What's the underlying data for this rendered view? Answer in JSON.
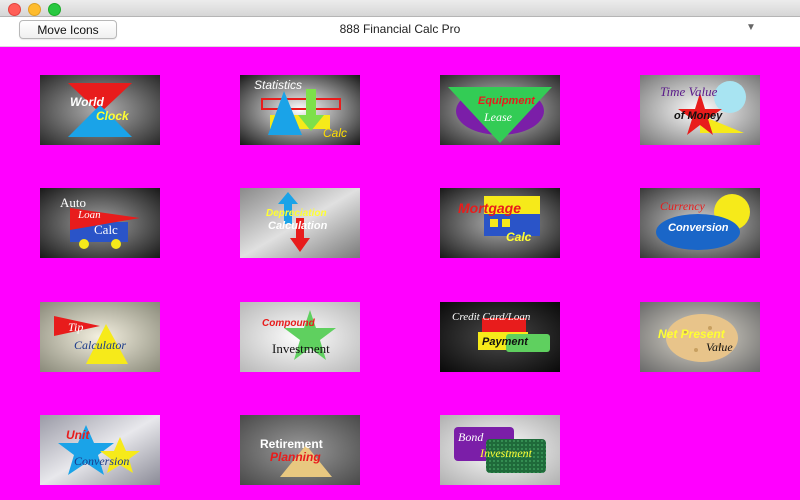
{
  "window": {
    "title": "888 Financial Calc Pro"
  },
  "toolbar": {
    "move_icons_label": "Move Icons",
    "dropdown_icon": "triangle-down"
  },
  "colors": {
    "background": "#ff00ff"
  },
  "tiles": [
    {
      "id": "world-clock",
      "lines": [
        "World",
        "Clock"
      ]
    },
    {
      "id": "statistics-calc",
      "lines": [
        "Statistics",
        "Calc"
      ]
    },
    {
      "id": "equipment-lease",
      "lines": [
        "Equipment",
        "Lease"
      ]
    },
    {
      "id": "time-value-money",
      "lines": [
        "Time Value",
        "of Money"
      ]
    },
    {
      "id": "auto-loan-calc",
      "lines": [
        "Auto",
        "Loan",
        "Calc"
      ]
    },
    {
      "id": "depreciation-calculation",
      "lines": [
        "Depreciation",
        "Calculation"
      ]
    },
    {
      "id": "mortgage-calc",
      "lines": [
        "Mortgage",
        "Calc"
      ]
    },
    {
      "id": "currency-conversion",
      "lines": [
        "Currency",
        "Conversion"
      ]
    },
    {
      "id": "tip-calculator",
      "lines": [
        "Tip",
        "Calculator"
      ]
    },
    {
      "id": "compound-investment",
      "lines": [
        "Compound",
        "Investment"
      ]
    },
    {
      "id": "credit-card-loan-payment",
      "lines": [
        "Credit Card/Loan",
        "Payment"
      ]
    },
    {
      "id": "net-present-value",
      "lines": [
        "Net Present",
        "Value"
      ]
    },
    {
      "id": "unit-conversion",
      "lines": [
        "Unit",
        "Conversion"
      ]
    },
    {
      "id": "retirement-planning",
      "lines": [
        "Retirement",
        "Planning"
      ]
    },
    {
      "id": "bond-investment",
      "lines": [
        "Bond",
        "Investment"
      ]
    }
  ]
}
